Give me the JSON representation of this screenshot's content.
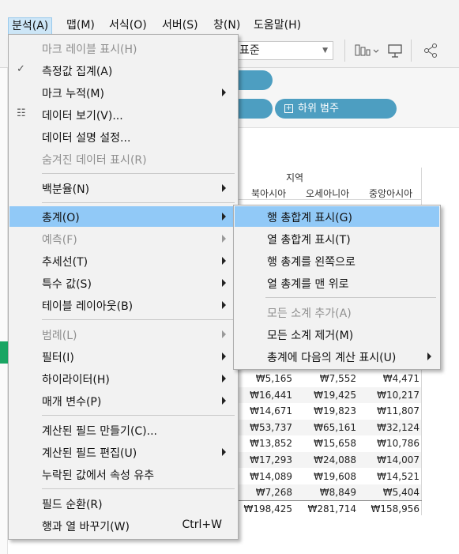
{
  "menubar": {
    "items": [
      "분석(A)",
      "맵(M)",
      "서식(O)",
      "서버(S)",
      "창(N)",
      "도움말(H)"
    ]
  },
  "toolbar": {
    "fit_value": "표준",
    "icons": [
      "show-me-icon",
      "presentation-icon",
      "share-icon"
    ]
  },
  "shelf": {
    "pill_label": "하위 범주"
  },
  "table": {
    "header_title": "지역",
    "columns": [
      "북아시아",
      "오세아니아",
      "중앙아시아"
    ],
    "rows": [
      [
        "₩5,165",
        "₩7,552",
        "₩4,471"
      ],
      [
        "₩16,441",
        "₩19,425",
        "₩10,217"
      ],
      [
        "₩14,671",
        "₩19,823",
        "₩11,807"
      ],
      [
        "₩53,737",
        "₩65,161",
        "₩32,124"
      ],
      [
        "₩13,852",
        "₩15,658",
        "₩10,786"
      ],
      [
        "₩17,293",
        "₩24,088",
        "₩14,007"
      ],
      [
        "₩14,089",
        "₩19,608",
        "₩14,521"
      ],
      [
        "₩7,268",
        "₩8,849",
        "₩5,404"
      ],
      [
        "₩198,425",
        "₩281,714",
        "₩158,956"
      ]
    ]
  },
  "analysis_menu": {
    "items": [
      {
        "label": "마크 레이블 표시(H)",
        "disabled": true
      },
      {
        "label": "측정값 집계(A)",
        "checked": true
      },
      {
        "label": "마크 누적(M)",
        "submenu": true
      },
      {
        "label": "데이터 보기(V)...",
        "icon": "view-data-icon"
      },
      {
        "label": "데이터 설명 설정..."
      },
      {
        "label": "숨겨진 데이터 표시(R)",
        "disabled": true
      },
      {
        "label": "백분율(N)",
        "submenu": true
      },
      {
        "label": "총계(O)",
        "submenu": true,
        "highlighted": true
      },
      {
        "label": "예측(F)",
        "submenu": true,
        "disabled": true
      },
      {
        "label": "추세선(T)",
        "submenu": true
      },
      {
        "label": "특수 값(S)",
        "submenu": true
      },
      {
        "label": "테이블 레이아웃(B)",
        "submenu": true
      },
      {
        "label": "범례(L)",
        "submenu": true,
        "disabled": true
      },
      {
        "label": "필터(I)",
        "submenu": true
      },
      {
        "label": "하이라이터(H)",
        "submenu": true
      },
      {
        "label": "매개 변수(P)",
        "submenu": true
      },
      {
        "label": "계산된 필드 만들기(C)..."
      },
      {
        "label": "계산된 필드 편집(U)",
        "submenu": true
      },
      {
        "label": "누락된 값에서 속성 유추"
      },
      {
        "label": "필드 순환(R)"
      },
      {
        "label": "행과 열 바꾸기(W)",
        "shortcut": "Ctrl+W"
      }
    ]
  },
  "totals_submenu": {
    "items": [
      {
        "label": "행 총합계 표시(G)",
        "highlighted": true
      },
      {
        "label": "열 총합계 표시(T)"
      },
      {
        "label": "행 총계를 왼쪽으로"
      },
      {
        "label": "열 총계를 맨 위로"
      },
      {
        "label": "모든 소계 추가(A)",
        "disabled": true
      },
      {
        "label": "모든 소계 제거(M)"
      },
      {
        "label": "총계에 다음의 계산 표시(U)",
        "submenu": true
      }
    ]
  },
  "colors": {
    "highlight": "#91c9f7",
    "menu_bg": "#f2f2f2",
    "pill": "#4d9ec1",
    "accent_green": "#1aa563"
  }
}
